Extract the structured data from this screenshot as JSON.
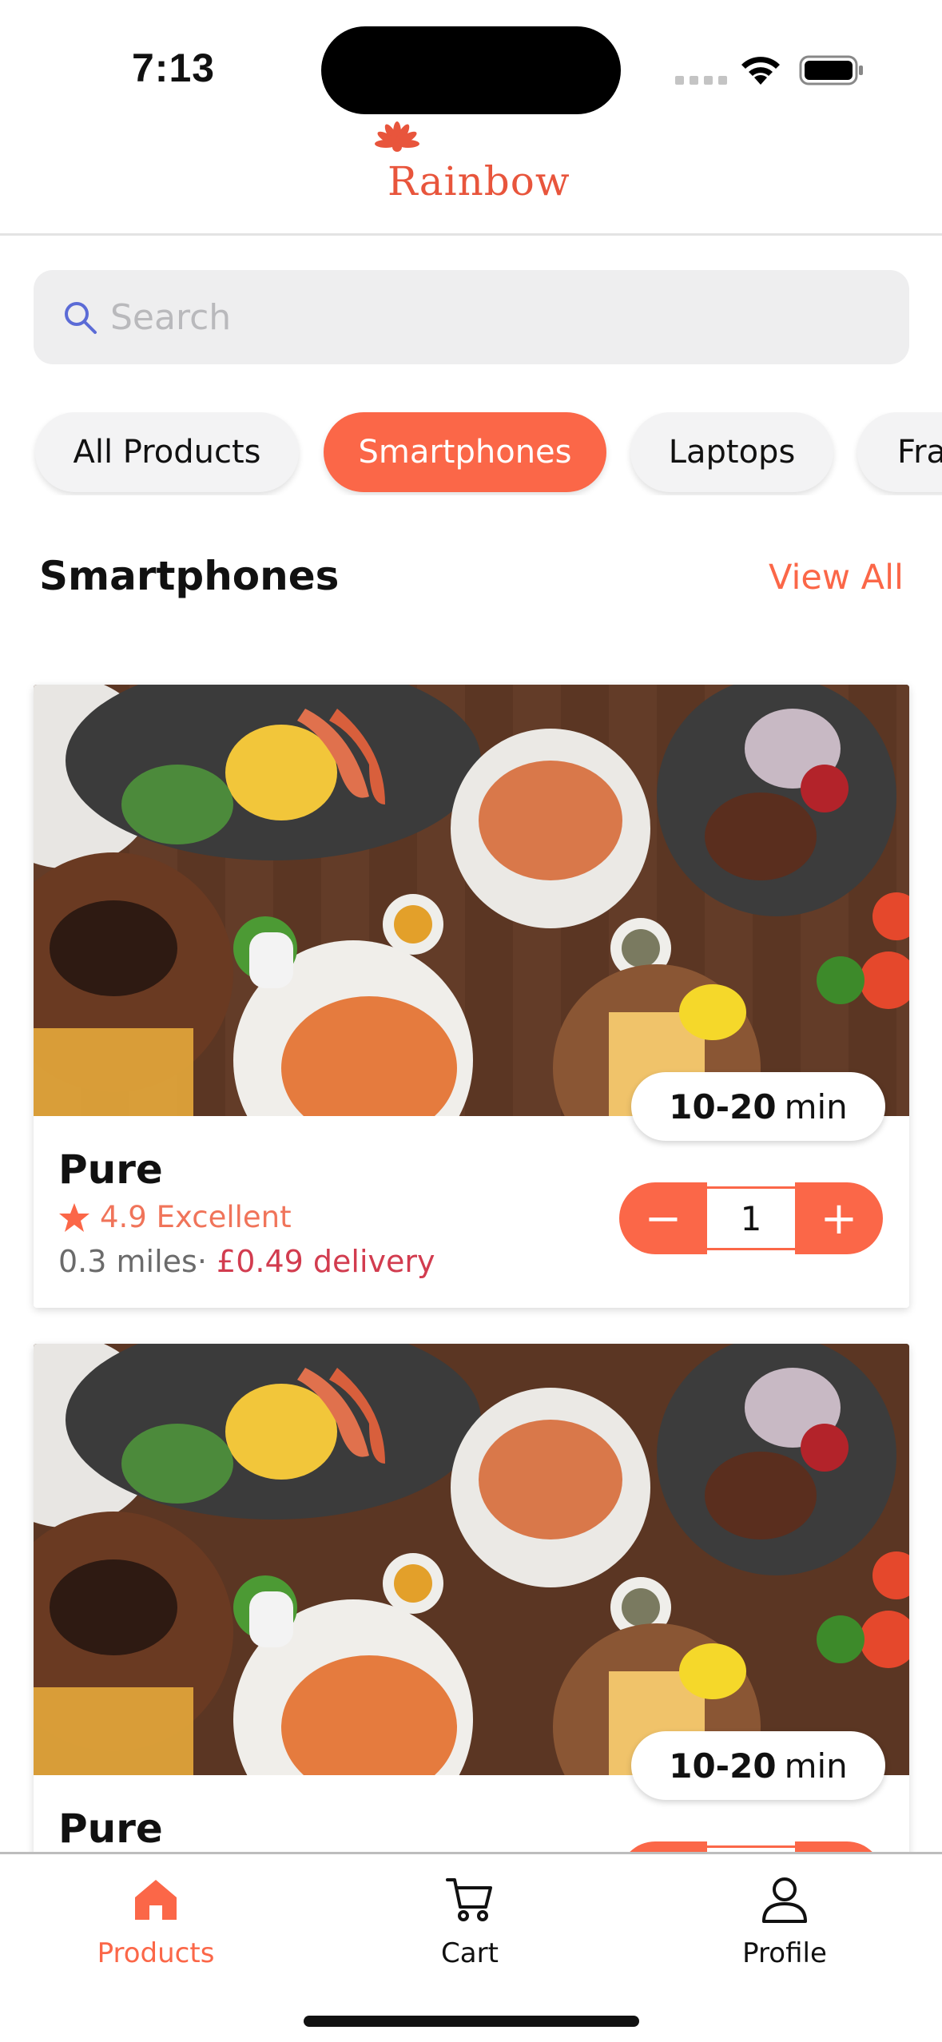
{
  "status_bar": {
    "time": "7:13"
  },
  "header": {
    "logo_text": "Rainbow",
    "brand_color": "#e8553c"
  },
  "search": {
    "placeholder": "Search",
    "value": ""
  },
  "categories": [
    {
      "label": "All Products",
      "active": false
    },
    {
      "label": "Smartphones",
      "active": true
    },
    {
      "label": "Laptops",
      "active": false
    },
    {
      "label": "Fra",
      "active": false
    }
  ],
  "section": {
    "title": "Smartphones",
    "view_all": "View All"
  },
  "products": [
    {
      "name": "Pure",
      "time_range": "10-20",
      "time_unit": "min",
      "rating": "4.9 Excellent",
      "distance": "0.3 miles",
      "separator": "·",
      "delivery_fee": "£0.49 delivery",
      "quantity": "1",
      "image_icon": "food-platter-photo"
    },
    {
      "name": "Pure",
      "time_range": "10-20",
      "time_unit": "min",
      "image_icon": "food-platter-photo"
    }
  ],
  "stepper": {
    "minus": "−",
    "plus": "+"
  },
  "nav": {
    "products": "Products",
    "cart": "Cart",
    "profile": "Profile"
  },
  "colors": {
    "accent": "#fb6748",
    "fee": "#d23c4f",
    "rating": "#f0745a"
  }
}
